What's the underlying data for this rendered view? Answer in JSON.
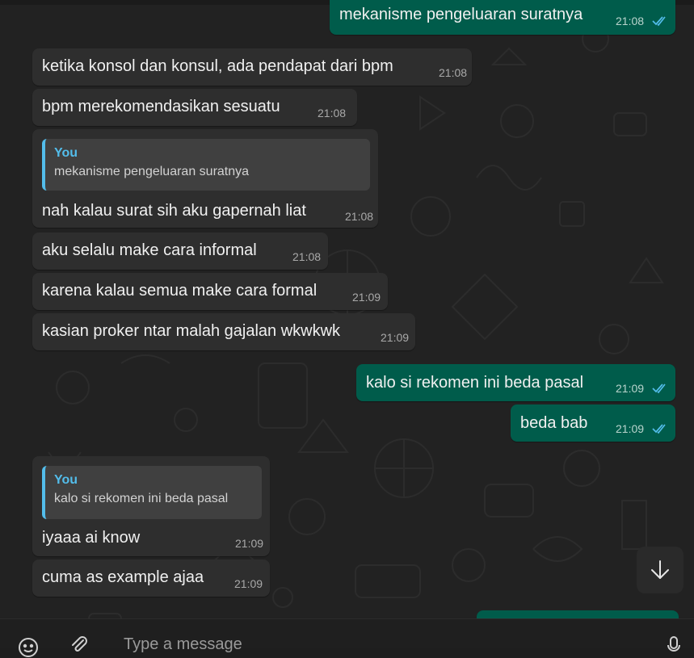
{
  "messages": [
    {
      "kind": "out",
      "text": "mekanisme pengeluaran suratnya",
      "time": "21:08",
      "read": true
    },
    {
      "kind": "in",
      "text": "ketika konsol dan konsul, ada pendapat dari bpm",
      "time": "21:08"
    },
    {
      "kind": "in",
      "text": "bpm merekomendasikan sesuatu",
      "time": "21:08"
    },
    {
      "kind": "in",
      "quote": {
        "author": "You",
        "text": "mekanisme pengeluaran suratnya"
      },
      "text": "nah kalau surat sih aku gapernah liat",
      "time": "21:08"
    },
    {
      "kind": "in",
      "text": "aku selalu make cara informal",
      "time": "21:08"
    },
    {
      "kind": "in",
      "text": "karena kalau semua make cara formal",
      "time": "21:09"
    },
    {
      "kind": "in",
      "text": "kasian proker ntar malah gajalan wkwkwk",
      "time": "21:09"
    },
    {
      "kind": "out",
      "text": "kalo si rekomen ini beda pasal",
      "time": "21:09",
      "read": true
    },
    {
      "kind": "out",
      "text": "beda bab",
      "time": "21:09",
      "read": true
    },
    {
      "kind": "in",
      "quote": {
        "author": "You",
        "text": "kalo si rekomen ini beda pasal"
      },
      "text": "iyaaa ai know",
      "time": "21:09"
    },
    {
      "kind": "in",
      "text": "cuma as example ajaa",
      "time": "21:09"
    }
  ],
  "composer": {
    "placeholder": "Type a message"
  },
  "icons": {
    "scroll": "arrow-down-icon",
    "emoji": "emoji-icon",
    "attach": "paperclip-icon",
    "mic": "microphone-icon",
    "read": "double-check-icon"
  },
  "colors": {
    "incoming": "#2e2e2e",
    "outgoing": "#005c4b",
    "quote_accent": "#53bdeb",
    "ticks": "#53bdeb"
  }
}
